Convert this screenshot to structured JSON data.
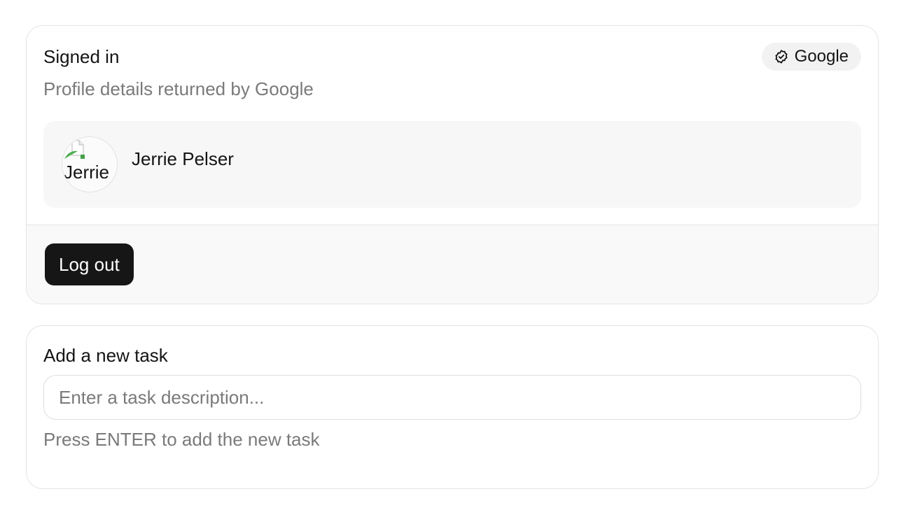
{
  "profile_card": {
    "title": "Signed in",
    "subtitle": "Profile details returned by Google",
    "provider_badge": {
      "label": "Google",
      "icon": "check-circle-icon"
    },
    "user": {
      "name": "Jerrie Pelser",
      "avatar_alt": "Jerrie",
      "avatar_icon": "broken-image-icon"
    },
    "logout_label": "Log out"
  },
  "task_card": {
    "label": "Add a new task",
    "input_value": "",
    "input_placeholder": "Enter a task description...",
    "hint": "Press ENTER to add the new task"
  },
  "colors": {
    "button_bg": "#161616",
    "muted_text": "#7a7a7a",
    "badge_bg": "#f2f2f2",
    "border": "#e4e4e4"
  }
}
